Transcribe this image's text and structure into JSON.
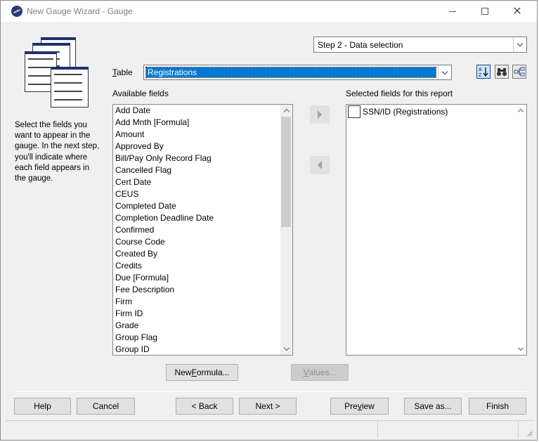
{
  "window": {
    "title": "New Gauge Wizard - Gauge",
    "controls": {
      "minimize": "minimize-icon",
      "maximize": "maximize-icon",
      "close": "close-icon"
    }
  },
  "sidebar": {
    "picture_icon": "report-pages-icon",
    "instructions": "Select the fields you want to appear in the gauge. In the next step, you'll indicate where each field appears in the gauge."
  },
  "step": {
    "selected": "Step 2 - Data selection"
  },
  "table": {
    "label_prefix": "T",
    "label_rest": "able",
    "selected": "Registrations"
  },
  "toolbar": {
    "sort_icon": "sort-az-icon",
    "find_icon": "binoculars-icon",
    "tree_icon": "tree-view-icon"
  },
  "available": {
    "label": "Available fields",
    "items": [
      "Add Date",
      "Add Mnth [Formula]",
      "Amount",
      "Approved By",
      "Bill/Pay Only Record Flag",
      "Cancelled Flag",
      "Cert Date",
      "CEUS",
      "Completed Date",
      "Completion Deadline Date",
      "Confirmed",
      "Course Code",
      "Created By",
      "Credits",
      "Due [Formula]",
      "Fee Description",
      "Firm",
      "Firm ID",
      "Grade",
      "Group Flag",
      "Group ID"
    ]
  },
  "selected": {
    "label": "Selected fields for this report",
    "items": [
      {
        "label": "SSN/ID (Registrations)",
        "checked": false
      }
    ]
  },
  "buttons": {
    "new_formula_pre": "New ",
    "new_formula_key": "F",
    "new_formula_post": "ormula...",
    "values_key": "V",
    "values_post": "alues...",
    "help": "Help",
    "cancel": "Cancel",
    "back": "< Back",
    "next": "Next >",
    "preview_pre": "Pre",
    "preview_key": "v",
    "preview_post": "iew",
    "save_as": "Save as...",
    "finish": "Finish"
  }
}
